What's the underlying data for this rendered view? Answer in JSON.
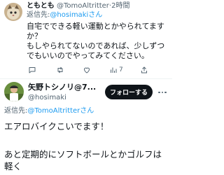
{
  "reply_tweet": {
    "author_name": "ともとも",
    "author_handle": "@TomoAltritter",
    "separator": "·",
    "time": "2時間",
    "reply_to_prefix": "返信先:",
    "reply_to_handle": "@hosimakiさん",
    "text": "自宅でできる軽い運動とかやられてますか？\nもしやられてないのであれば、少しずつでもいいのでやってみてください。",
    "actions": {
      "view_count": "7"
    }
  },
  "main_tweet": {
    "author_name": "矢野トシノリ@7...",
    "author_handle": "@hosimaki",
    "follow_label": "フォローする",
    "reply_to_prefix": "返信先:",
    "reply_to_handle": "@TomoAltritterさん",
    "text_line1": "エアロバイクこいでます！",
    "text_line2": "あと定期的にソフトボールとかゴルフは軽く"
  },
  "colors": {
    "link": "#1d9bf0",
    "follow_bg": "#0f1419",
    "muted": "#536471"
  }
}
